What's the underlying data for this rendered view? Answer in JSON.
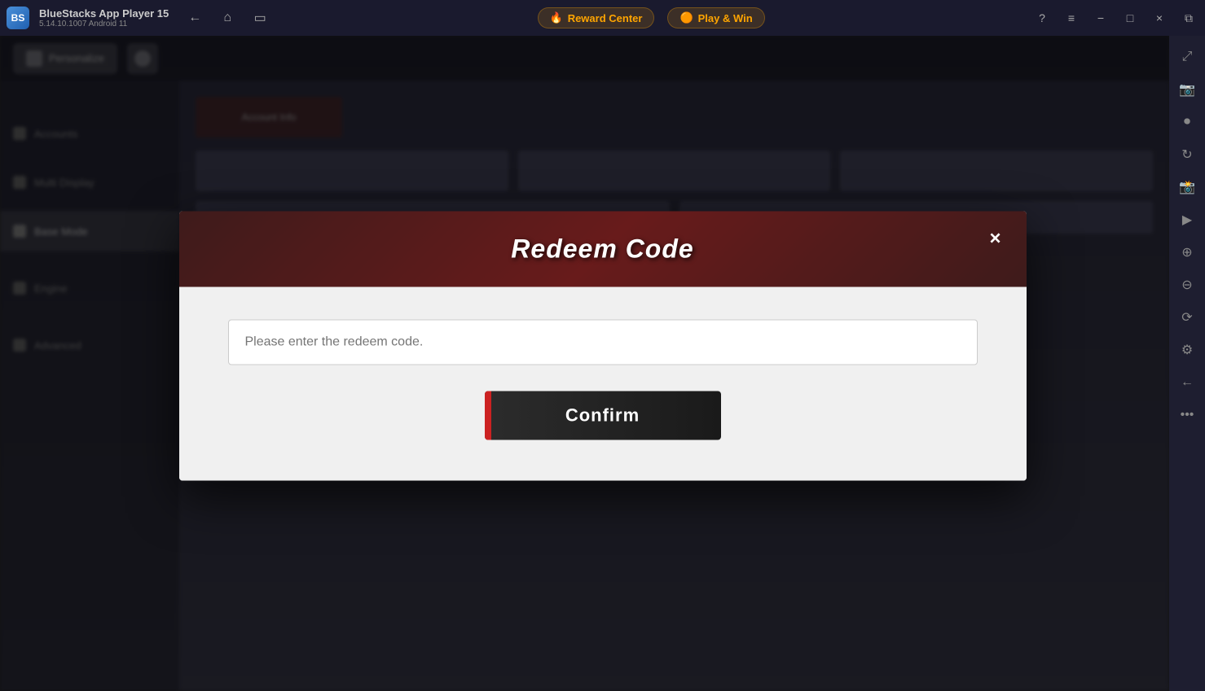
{
  "titleBar": {
    "appName": "BlueStacks App Player 15",
    "appVersion": "5.14.10.1007  Android 11",
    "rewardCenter": "Reward Center",
    "playWin": "Play & Win"
  },
  "windowControls": {
    "minimize": "−",
    "maximize": "□",
    "close": "×",
    "restore": "⧉",
    "menu": "≡",
    "help": "?"
  },
  "dialog": {
    "title": "Redeem Code",
    "closeIcon": "×",
    "inputPlaceholder": "Please enter the redeem code.",
    "confirmButton": "Confirm"
  },
  "sidebarIcons": [
    "expand-icon",
    "screenshot-icon",
    "screen-record-icon",
    "refresh-icon",
    "camera-icon",
    "media-icon",
    "zoom-in-icon",
    "zoom-out-icon",
    "rotate-icon",
    "settings-icon",
    "arrow-icon",
    "more-icon"
  ]
}
